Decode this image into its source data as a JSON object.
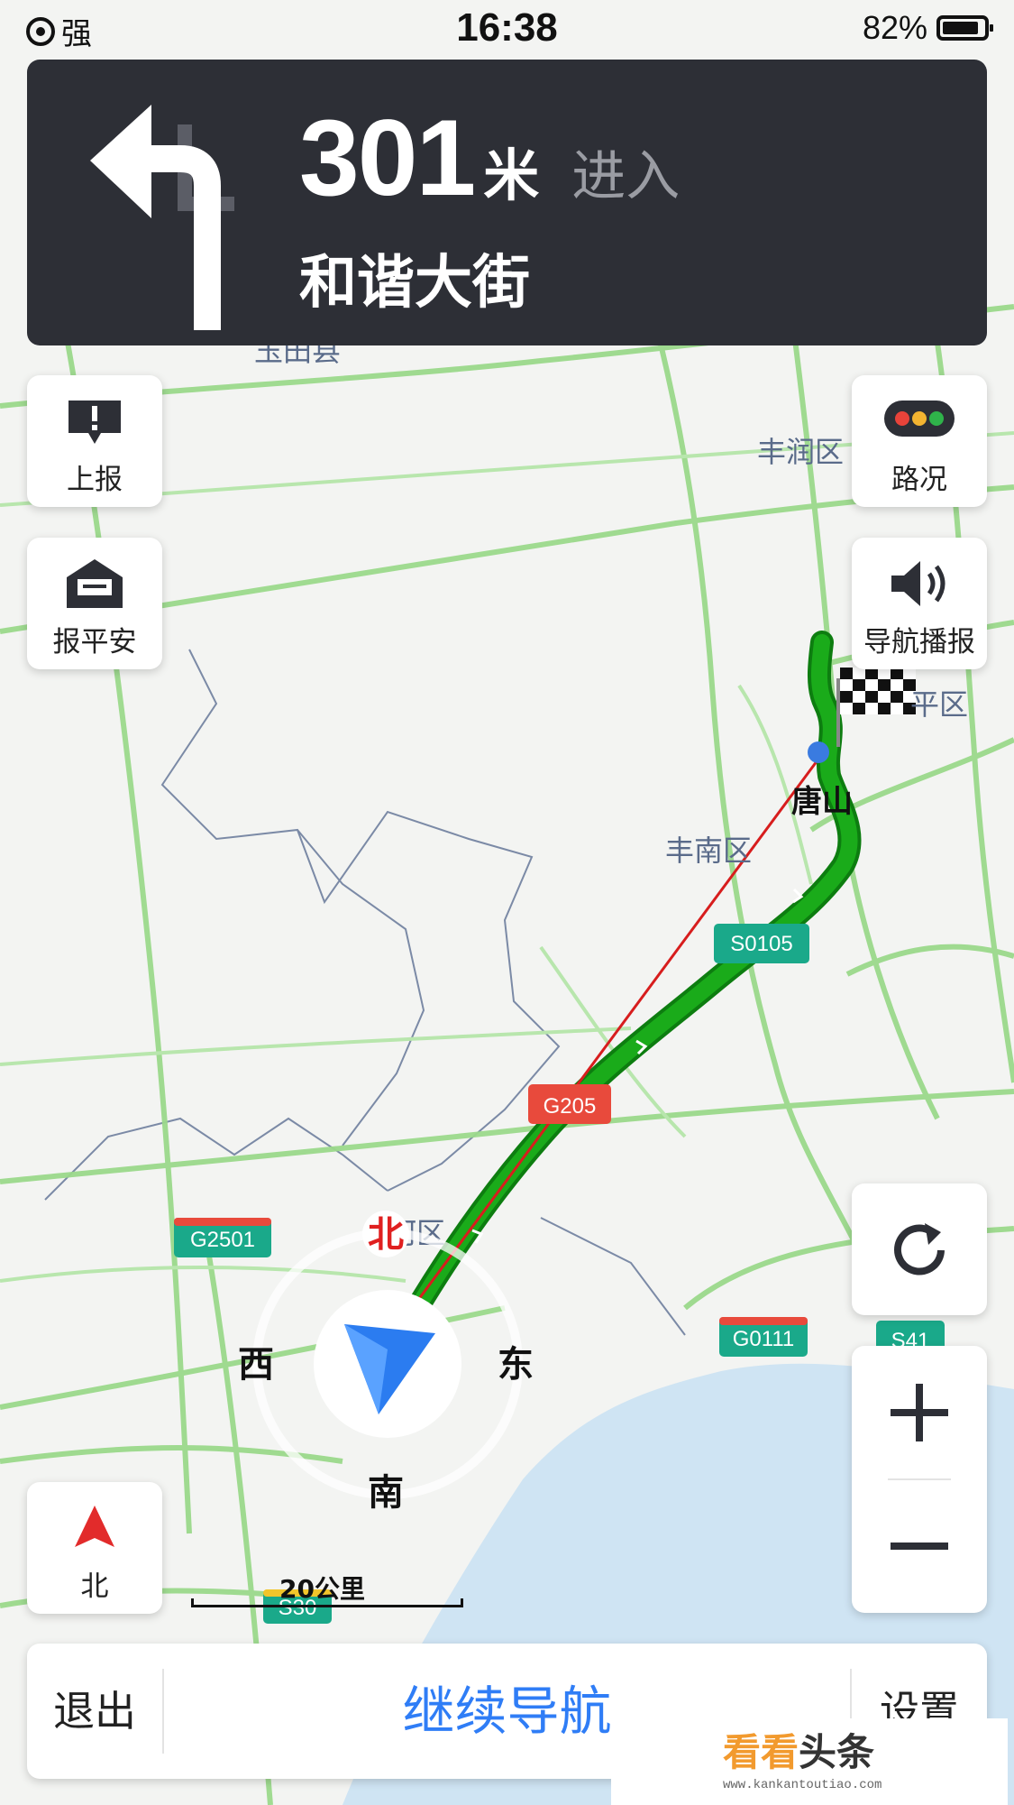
{
  "status": {
    "signal": "强",
    "time": "16:38",
    "battery": "82%"
  },
  "navigation": {
    "distance": "301",
    "unit": "米",
    "action": "进入",
    "street": "和谐大街"
  },
  "side_buttons": {
    "report": "上报",
    "safe": "报平安",
    "traffic": "路况",
    "voice": "导航播报",
    "north": "北"
  },
  "compass": {
    "north": "北",
    "south": "南",
    "east": "东",
    "west": "西"
  },
  "map": {
    "places": [
      "丰润区",
      "平区",
      "唐山",
      "丰南区",
      "河区",
      "玉田县"
    ],
    "roads": [
      "S0105",
      "G205",
      "G2501",
      "G0111",
      "S41",
      "S30"
    ]
  },
  "scale": "20公里",
  "bottom": {
    "exit": "退出",
    "continue": "继续导航",
    "settings": "设置"
  },
  "watermark": {
    "brand_a": "看看",
    "brand_b": "头条",
    "url": "www.kankantoutiao.com"
  },
  "colors": {
    "route": "#1aab1a",
    "accent": "#2f7df6",
    "navcard": "#2d2f36",
    "highway_green": "#1aa98a",
    "highway_red": "#e84a3c"
  }
}
